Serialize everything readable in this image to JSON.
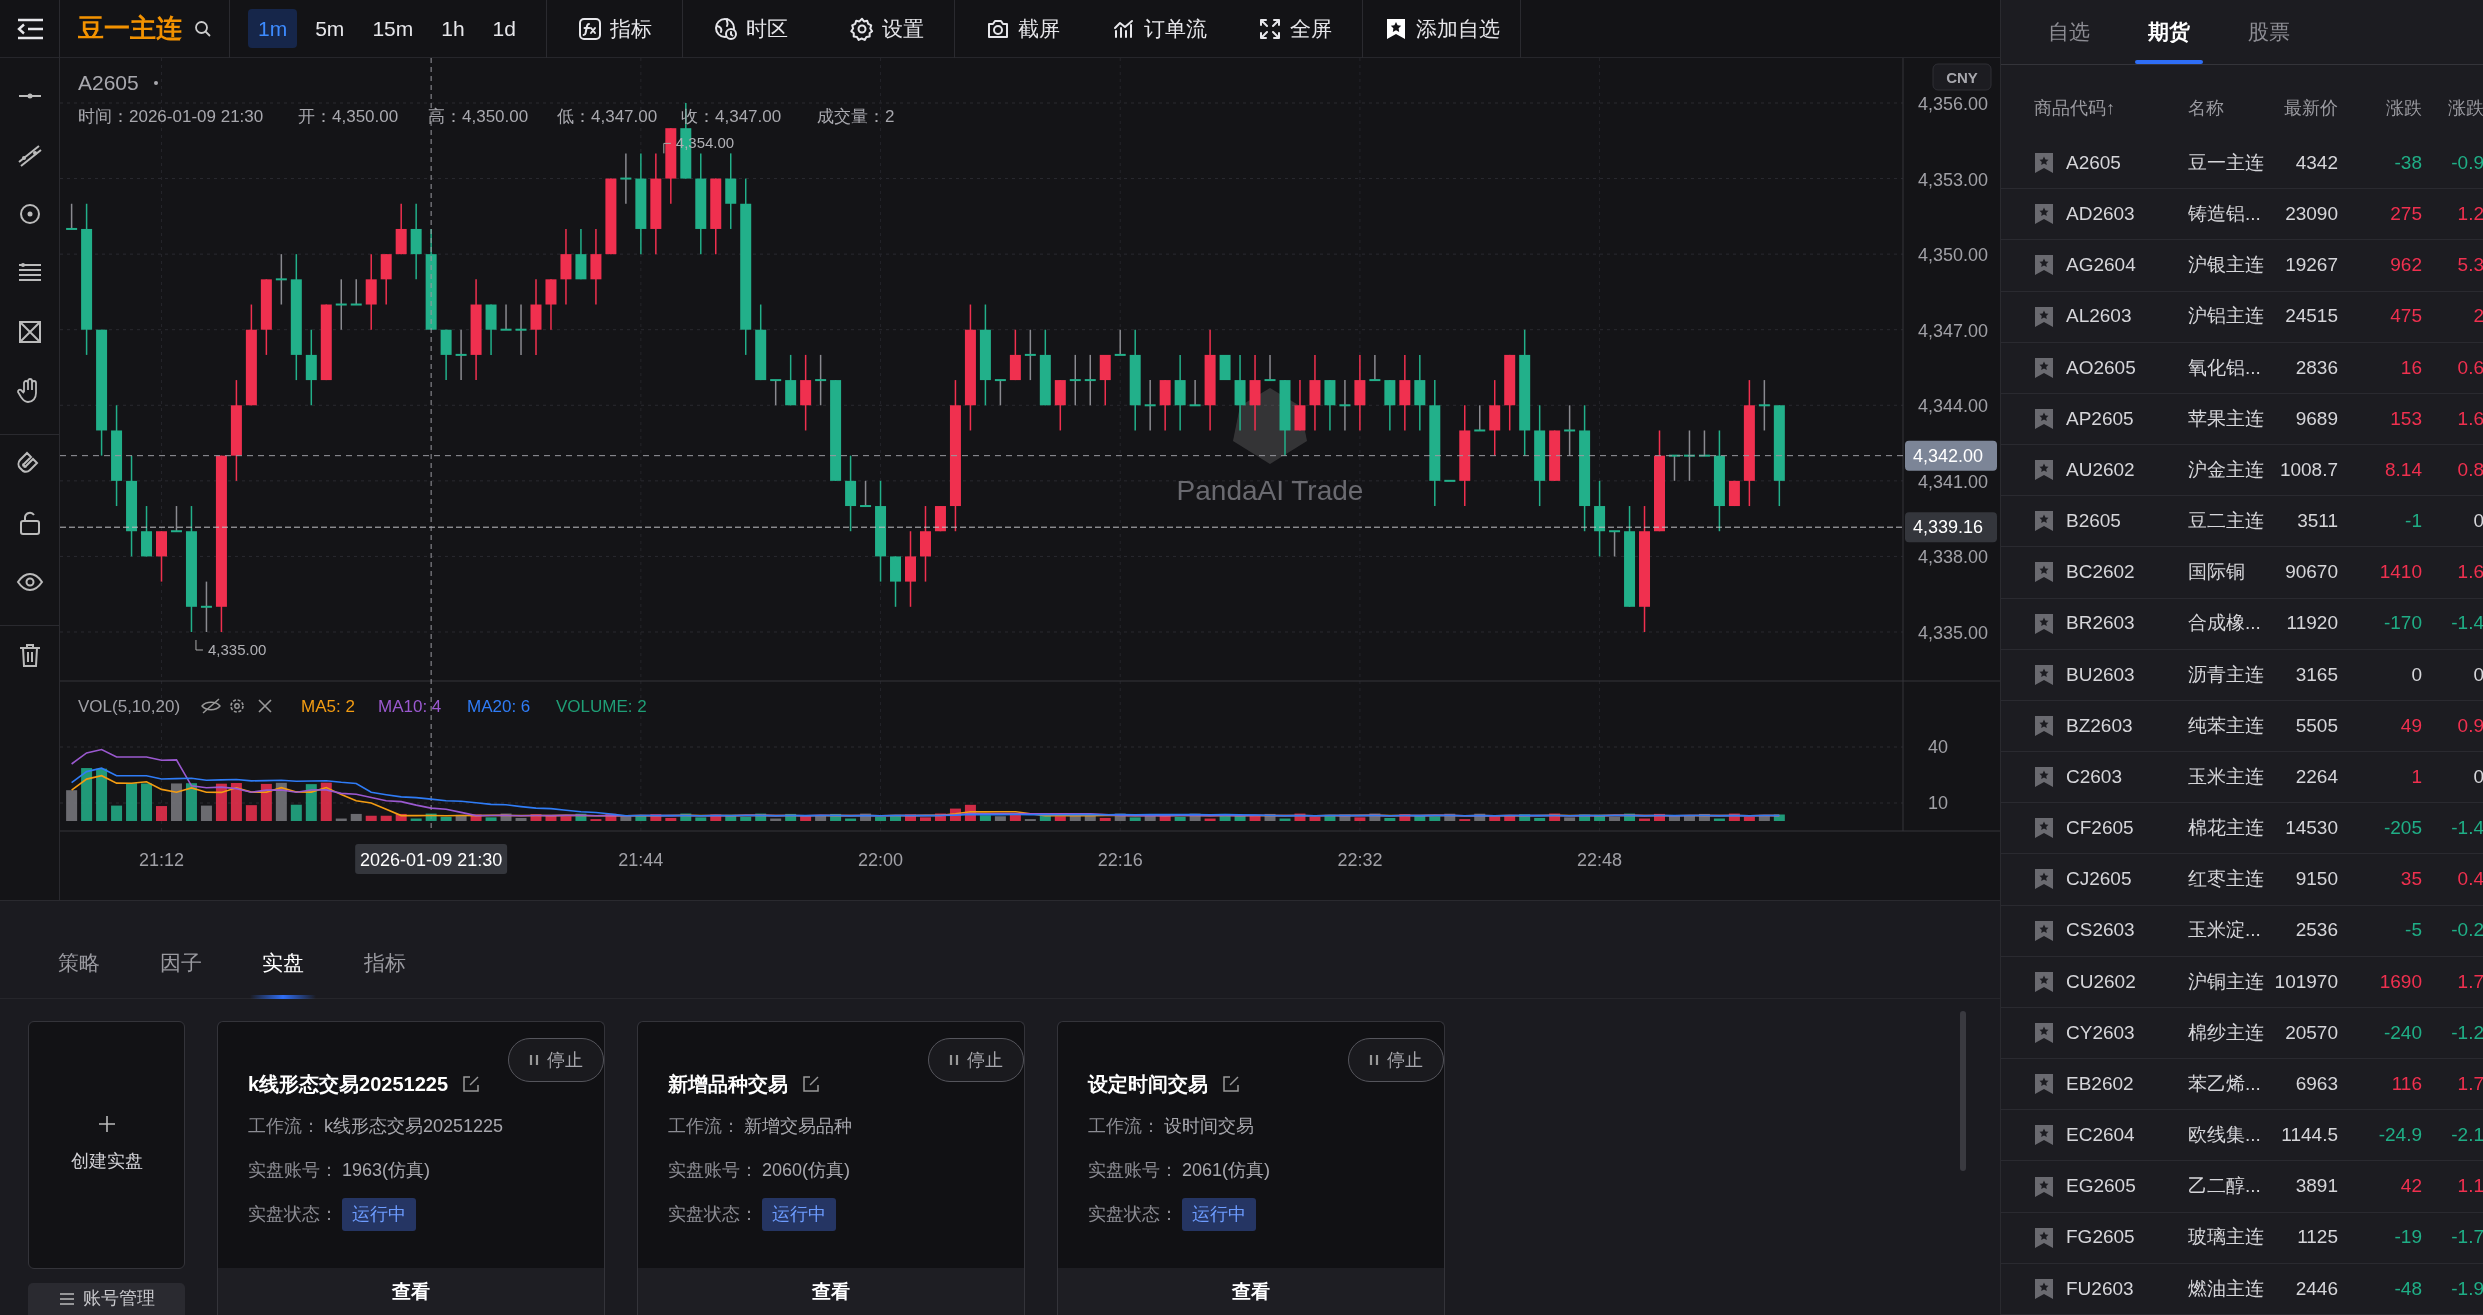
{
  "topbar": {
    "symbol": "豆一主连",
    "intervals": [
      {
        "label": "1m",
        "selected": true
      },
      {
        "label": "5m",
        "selected": false
      },
      {
        "label": "15m",
        "selected": false
      },
      {
        "label": "1h",
        "selected": false
      },
      {
        "label": "1d",
        "selected": false
      }
    ],
    "tools": [
      {
        "kind": "indicator",
        "label": "指标"
      },
      {
        "kind": "timezone",
        "label": "时区"
      },
      {
        "kind": "settings",
        "label": "设置"
      },
      {
        "kind": "screenshot",
        "label": "截屏"
      },
      {
        "kind": "orderflow",
        "label": "订单流"
      },
      {
        "kind": "fullscreen",
        "label": "全屏"
      },
      {
        "kind": "watchlist",
        "label": "添加自选"
      }
    ]
  },
  "chart": {
    "symbol": "A2605",
    "info": [
      "时间：2026-01-09 21:30",
      "开：4,350.00",
      "高：4,350.00",
      "低：4,347.00",
      "收：4,347.00",
      "成交量：2"
    ],
    "currency": "CNY",
    "price_labels": [
      "4,356.00",
      "4,353.00",
      "4,350.00",
      "4,347.00",
      "4,344.00",
      "4,341.00",
      "4,338.00",
      "4,335.00"
    ],
    "last_price": "4,342.00",
    "marker_price": "4,339.16",
    "high_label": "4,354.00",
    "low_label": "4,335.00",
    "watermark": "PandaAI Trade",
    "crosshair_time": "2026-01-09 21:30",
    "time_labels": [
      "21:12",
      "21:44",
      "22:00",
      "22:16",
      "22:32",
      "22:48"
    ]
  },
  "volume": {
    "title": "VOL(5,10,20)",
    "legend": [
      {
        "label": "MA5: 2",
        "color": "#f39c12"
      },
      {
        "label": "MA10: 4",
        "color": "#9b59d0"
      },
      {
        "label": "MA20: 6",
        "color": "#2f7cf6"
      },
      {
        "label": "VOLUME: 2",
        "color": "#1f9e76"
      }
    ],
    "axis_labels": [
      "40",
      "10"
    ]
  },
  "market": {
    "tabs": [
      {
        "label": "自选",
        "selected": false
      },
      {
        "label": "期货",
        "selected": true
      },
      {
        "label": "股票",
        "selected": false
      }
    ],
    "columns": [
      "商品代码↑",
      "名称",
      "最新价",
      "涨跌",
      "涨跌"
    ],
    "rows": [
      {
        "code": "A2605",
        "name": "豆一主连",
        "price": "4342",
        "change": {
          "text": "-38",
          "color": "#1fae86"
        },
        "pct": {
          "text": "-0.9",
          "color": "#1fae86"
        }
      },
      {
        "code": "AD2603",
        "name": "铸造铝...",
        "price": "23090",
        "change": {
          "text": "275",
          "color": "#f0304f"
        },
        "pct": {
          "text": "1.2",
          "color": "#f0304f"
        }
      },
      {
        "code": "AG2604",
        "name": "沪银主连",
        "price": "19267",
        "change": {
          "text": "962",
          "color": "#f0304f"
        },
        "pct": {
          "text": "5.3",
          "color": "#f0304f"
        }
      },
      {
        "code": "AL2603",
        "name": "沪铝主连",
        "price": "24515",
        "change": {
          "text": "475",
          "color": "#f0304f"
        },
        "pct": {
          "text": "2",
          "color": "#f0304f"
        }
      },
      {
        "code": "AO2605",
        "name": "氧化铝...",
        "price": "2836",
        "change": {
          "text": "16",
          "color": "#f0304f"
        },
        "pct": {
          "text": "0.6",
          "color": "#f0304f"
        }
      },
      {
        "code": "AP2605",
        "name": "苹果主连",
        "price": "9689",
        "change": {
          "text": "153",
          "color": "#f0304f"
        },
        "pct": {
          "text": "1.6",
          "color": "#f0304f"
        }
      },
      {
        "code": "AU2602",
        "name": "沪金主连",
        "price": "1008.7",
        "change": {
          "text": "8.14",
          "color": "#f0304f"
        },
        "pct": {
          "text": "0.8",
          "color": "#f0304f"
        }
      },
      {
        "code": "B2605",
        "name": "豆二主连",
        "price": "3511",
        "change": {
          "text": "-1",
          "color": "#1fae86"
        },
        "pct": {
          "text": "0",
          "color": "#d6d6da"
        }
      },
      {
        "code": "BC2602",
        "name": "国际铜",
        "price": "90670",
        "change": {
          "text": "1410",
          "color": "#f0304f"
        },
        "pct": {
          "text": "1.6",
          "color": "#f0304f"
        }
      },
      {
        "code": "BR2603",
        "name": "合成橡...",
        "price": "11920",
        "change": {
          "text": "-170",
          "color": "#1fae86"
        },
        "pct": {
          "text": "-1.4",
          "color": "#1fae86"
        }
      },
      {
        "code": "BU2603",
        "name": "沥青主连",
        "price": "3165",
        "change": {
          "text": "0",
          "color": "#d6d6da"
        },
        "pct": {
          "text": "0",
          "color": "#d6d6da"
        }
      },
      {
        "code": "BZ2603",
        "name": "纯苯主连",
        "price": "5505",
        "change": {
          "text": "49",
          "color": "#f0304f"
        },
        "pct": {
          "text": "0.9",
          "color": "#f0304f"
        }
      },
      {
        "code": "C2603",
        "name": "玉米主连",
        "price": "2264",
        "change": {
          "text": "1",
          "color": "#f0304f"
        },
        "pct": {
          "text": "0",
          "color": "#d6d6da"
        }
      },
      {
        "code": "CF2605",
        "name": "棉花主连",
        "price": "14530",
        "change": {
          "text": "-205",
          "color": "#1fae86"
        },
        "pct": {
          "text": "-1.4",
          "color": "#1fae86"
        }
      },
      {
        "code": "CJ2605",
        "name": "红枣主连",
        "price": "9150",
        "change": {
          "text": "35",
          "color": "#f0304f"
        },
        "pct": {
          "text": "0.4",
          "color": "#f0304f"
        }
      },
      {
        "code": "CS2603",
        "name": "玉米淀...",
        "price": "2536",
        "change": {
          "text": "-5",
          "color": "#1fae86"
        },
        "pct": {
          "text": "-0.2",
          "color": "#1fae86"
        }
      },
      {
        "code": "CU2602",
        "name": "沪铜主连",
        "price": "101970",
        "change": {
          "text": "1690",
          "color": "#f0304f"
        },
        "pct": {
          "text": "1.7",
          "color": "#f0304f"
        }
      },
      {
        "code": "CY2603",
        "name": "棉纱主连",
        "price": "20570",
        "change": {
          "text": "-240",
          "color": "#1fae86"
        },
        "pct": {
          "text": "-1.2",
          "color": "#1fae86"
        }
      },
      {
        "code": "EB2602",
        "name": "苯乙烯...",
        "price": "6963",
        "change": {
          "text": "116",
          "color": "#f0304f"
        },
        "pct": {
          "text": "1.7",
          "color": "#f0304f"
        }
      },
      {
        "code": "EC2604",
        "name": "欧线集...",
        "price": "1144.5",
        "change": {
          "text": "-24.9",
          "color": "#1fae86"
        },
        "pct": {
          "text": "-2.1",
          "color": "#1fae86"
        }
      },
      {
        "code": "EG2605",
        "name": "乙二醇...",
        "price": "3891",
        "change": {
          "text": "42",
          "color": "#f0304f"
        },
        "pct": {
          "text": "1.1",
          "color": "#f0304f"
        }
      },
      {
        "code": "FG2605",
        "name": "玻璃主连",
        "price": "1125",
        "change": {
          "text": "-19",
          "color": "#1fae86"
        },
        "pct": {
          "text": "-1.7",
          "color": "#1fae86"
        }
      },
      {
        "code": "FU2603",
        "name": "燃油主连",
        "price": "2446",
        "change": {
          "text": "-48",
          "color": "#1fae86"
        },
        "pct": {
          "text": "-1.9",
          "color": "#1fae86"
        }
      }
    ]
  },
  "bottom": {
    "tabs": [
      {
        "label": "策略",
        "selected": false
      },
      {
        "label": "因子",
        "selected": false
      },
      {
        "label": "实盘",
        "selected": true
      },
      {
        "label": "指标",
        "selected": false
      }
    ],
    "create_label": "创建实盘",
    "account_button": "账号管理",
    "strategies": [
      {
        "title": "k线形态交易20251225",
        "fields": [
          {
            "label": "工作流：",
            "value": "k线形态交易20251225"
          },
          {
            "label": "实盘账号：",
            "value": "1963(仿真)"
          }
        ],
        "status_label": "实盘状态：",
        "status": "运行中",
        "stop": "停止",
        "view": "查看"
      },
      {
        "title": "新增品种交易",
        "fields": [
          {
            "label": "工作流：",
            "value": "新增交易品种"
          },
          {
            "label": "实盘账号：",
            "value": "2060(仿真)"
          }
        ],
        "status_label": "实盘状态：",
        "status": "运行中",
        "stop": "停止",
        "view": "查看"
      },
      {
        "title": "设定时间交易",
        "fields": [
          {
            "label": "工作流：",
            "value": "设时间交易"
          },
          {
            "label": "实盘账号：",
            "value": "2061(仿真)"
          }
        ],
        "status_label": "实盘状态：",
        "status": "运行中",
        "stop": "停止",
        "view": "查看"
      }
    ]
  }
}
